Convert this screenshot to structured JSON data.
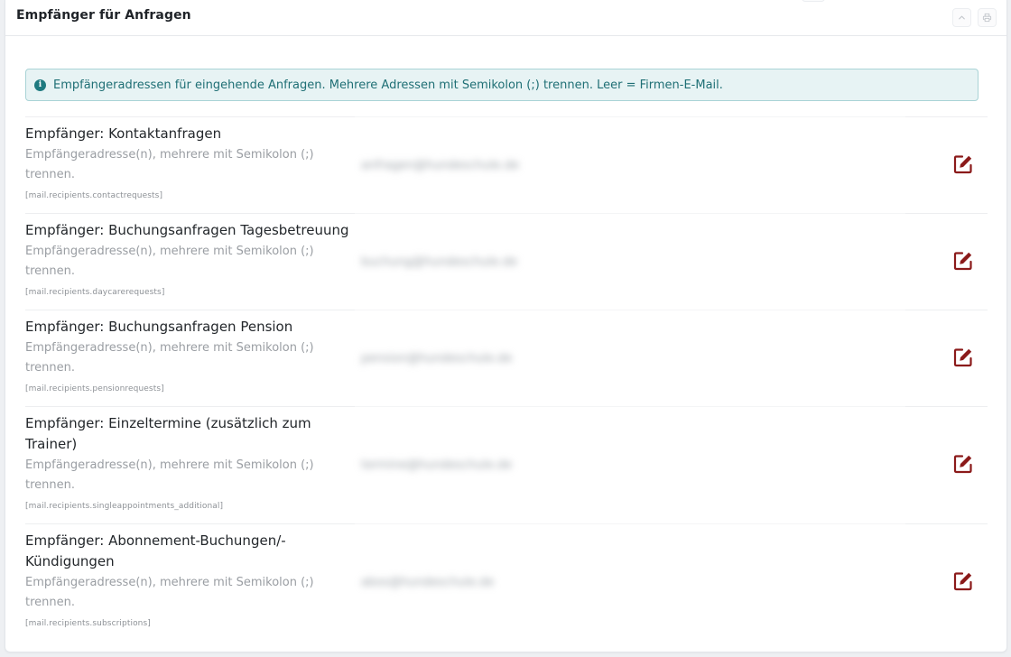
{
  "panel": {
    "title": "Empfänger für Anfragen"
  },
  "info": {
    "icon": "info-circle-icon",
    "text": "Empfängeradressen für eingehende Anfragen. Mehrere Adressen mit Semikolon (;) trennen. Leer = Firmen-E-Mail."
  },
  "colors": {
    "accent": "#8b1a1a",
    "info_bg": "#e7f3f4",
    "info_border": "#a9d3d6",
    "info_text": "#1f6f75"
  },
  "settings": [
    {
      "label": "Empfänger: Kontaktanfragen",
      "help": "Empfängeradresse(n), mehrere mit Semikolon (;) trennen.",
      "key": "[mail.recipients.contactrequests]",
      "value": "anfragen@hundeschule.de"
    },
    {
      "label": "Empfänger: Buchungsanfragen Tagesbetreuung",
      "help": "Empfängeradresse(n), mehrere mit Semikolon (;) trennen.",
      "key": "[mail.recipients.daycarerequests]",
      "value": "buchung@hundeschule.de"
    },
    {
      "label": "Empfänger: Buchungsanfragen Pension",
      "help": "Empfängeradresse(n), mehrere mit Semikolon (;) trennen.",
      "key": "[mail.recipients.pensionrequests]",
      "value": "pension@hundeschule.de"
    },
    {
      "label": "Empfänger: Einzeltermine (zusätzlich zum Trainer)",
      "help": "Empfängeradresse(n), mehrere mit Semikolon (;) trennen.",
      "key": "[mail.recipients.singleappointments_additional]",
      "value": "termine@hundeschule.de"
    },
    {
      "label": "Empfänger: Abonnement-Buchungen/-Kündigungen",
      "help": "Empfängeradresse(n), mehrere mit Semikolon (;) trennen.",
      "key": "[mail.recipients.subscriptions]",
      "value": "abos@hundeschule.de"
    }
  ]
}
